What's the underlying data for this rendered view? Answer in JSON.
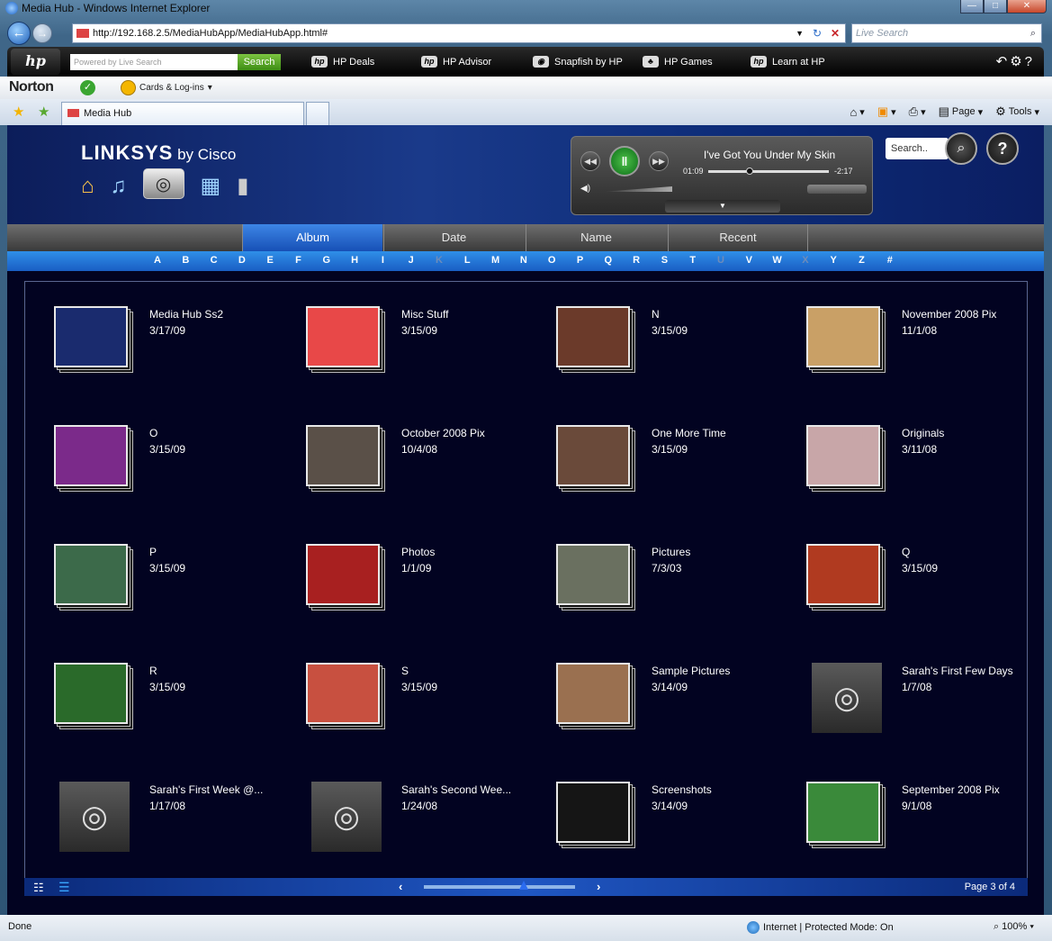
{
  "window": {
    "title": "Media Hub - Windows Internet Explorer"
  },
  "browser": {
    "url": "http://192.168.2.5/MediaHubApp/MediaHubApp.html#",
    "live_search_placeholder": "Live Search",
    "tab_title": "Media Hub",
    "commands": [
      "Page",
      "Tools"
    ]
  },
  "hp_toolbar": {
    "logo": "hp",
    "search_placeholder": "Powered by Live Search",
    "search_button": "Search",
    "links": [
      "HP Deals",
      "HP Advisor",
      "Snapfish by HP",
      "HP Games",
      "Learn at HP"
    ]
  },
  "norton": {
    "brand": "Norton",
    "cards": "Cards & Log-ins"
  },
  "app": {
    "brand_main": "LINKSYS",
    "brand_by": "by Cisco",
    "search_placeholder": "Search..",
    "help": "?",
    "player": {
      "song": "I've Got You Under My Skin",
      "elapsed": "01:09",
      "remaining": "-2:17",
      "progress": 0.34
    },
    "sort_tabs": [
      "Album",
      "Date",
      "Name",
      "Recent"
    ],
    "active_sort": "Album",
    "letters": [
      "A",
      "B",
      "C",
      "D",
      "E",
      "F",
      "G",
      "H",
      "I",
      "J",
      "K",
      "L",
      "M",
      "N",
      "O",
      "P",
      "Q",
      "R",
      "S",
      "T",
      "U",
      "V",
      "W",
      "X",
      "Y",
      "Z",
      "#"
    ],
    "dim_letters": [
      "K",
      "U",
      "X"
    ],
    "albums": [
      {
        "name": "Media Hub Ss2",
        "date": "3/17/09",
        "thumb": "#1a2b6e"
      },
      {
        "name": "Misc Stuff",
        "date": "3/15/09",
        "thumb": "#e84848"
      },
      {
        "name": "N",
        "date": "3/15/09",
        "thumb": "#6b3a2a"
      },
      {
        "name": "November 2008 Pix",
        "date": "11/1/08",
        "thumb": "#c9a066"
      },
      {
        "name": "O",
        "date": "3/15/09",
        "thumb": "#7b2a8a"
      },
      {
        "name": "October 2008 Pix",
        "date": "10/4/08",
        "thumb": "#5a5048"
      },
      {
        "name": "One More Time",
        "date": "3/15/09",
        "thumb": "#6a4a3a"
      },
      {
        "name": "Originals",
        "date": "3/11/08",
        "thumb": "#c8a6a8"
      },
      {
        "name": "P",
        "date": "3/15/09",
        "thumb": "#3c6a4a"
      },
      {
        "name": "Photos",
        "date": "1/1/09",
        "thumb": "#a82020"
      },
      {
        "name": "Pictures",
        "date": "7/3/03",
        "thumb": "#6a7060"
      },
      {
        "name": "Q",
        "date": "3/15/09",
        "thumb": "#b03a20"
      },
      {
        "name": "R",
        "date": "3/15/09",
        "thumb": "#2a6a2a"
      },
      {
        "name": "S",
        "date": "3/15/09",
        "thumb": "#c85040"
      },
      {
        "name": "Sample Pictures",
        "date": "3/14/09",
        "thumb": "#9a7050"
      },
      {
        "name": "Sarah's First Few Days",
        "date": "1/7/08",
        "thumb": "camera"
      },
      {
        "name": "Sarah's First Week @...",
        "date": "1/17/08",
        "thumb": "camera"
      },
      {
        "name": "Sarah's Second Wee...",
        "date": "1/24/08",
        "thumb": "camera"
      },
      {
        "name": "Screenshots",
        "date": "3/14/09",
        "thumb": "#151515"
      },
      {
        "name": "September 2008 Pix",
        "date": "9/1/08",
        "thumb": "#3a8a3a"
      }
    ],
    "pagination": {
      "page": "Page 3 of 4",
      "position": 0.66
    }
  },
  "status": {
    "text": "Done",
    "zone": "Internet | Protected Mode: On",
    "zoom": "100%"
  }
}
